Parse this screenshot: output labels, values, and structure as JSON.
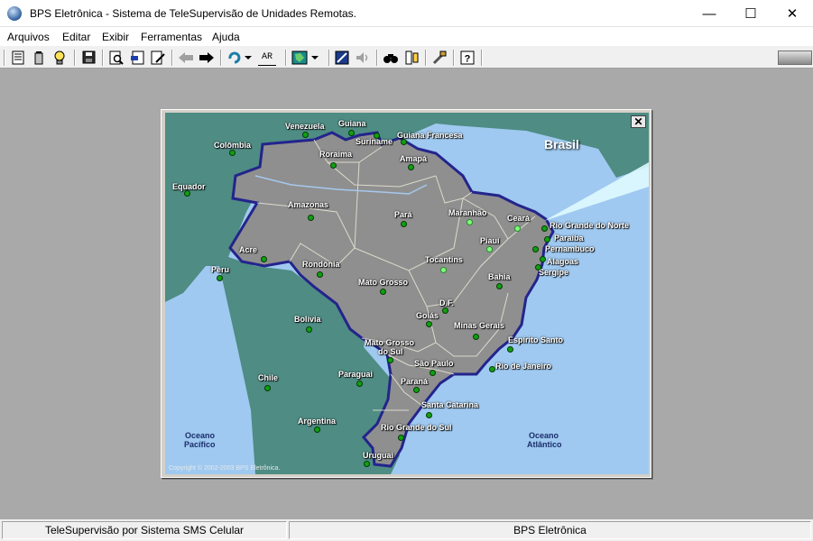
{
  "window": {
    "title": "BPS Eletrônica - Sistema de TeleSupervisão de Unidades Remotas.",
    "minimize_glyph": "—",
    "maximize_glyph": "☐",
    "close_glyph": "✕"
  },
  "menu": {
    "arquivos": "Arquivos",
    "editar": "Editar",
    "exibir": "Exibir",
    "ferramentas": "Ferramentas",
    "ajuda": "Ajuda"
  },
  "toolbar": {
    "ar_label": "AR",
    "icons": [
      "document-icon",
      "battery-icon",
      "bulb-icon",
      "save-icon",
      "print-preview-icon",
      "export-icon",
      "edit-icon",
      "back-arrow-icon",
      "forward-arrow-icon",
      "refresh-icon",
      "ar-icon",
      "map-select-icon",
      "satellite-icon",
      "speaker-icon",
      "binoculars-icon",
      "meter-icon",
      "tools-icon",
      "help-icon"
    ]
  },
  "map": {
    "title": "Brasil",
    "close_glyph": "✕",
    "copyright": "Copyright © 2002-2003 BPS Eletrônica.",
    "countries": {
      "venezuela": "Venezuela",
      "guiana": "Guiana",
      "suriname": "Suriname",
      "guiana_francesa": "Guiana Francesa",
      "colombia": "Colômbia",
      "equador": "Equador",
      "peru": "Peru",
      "bolivia": "Bolívia",
      "chile": "Chile",
      "paraguai": "Paraguai",
      "argentina": "Argentina",
      "uruguai": "Uruguai"
    },
    "oceans": {
      "pacifico_1": "Oceano",
      "pacifico_2": "Pacífico",
      "atlantico_1": "Oceano",
      "atlantico_2": "Atlântico"
    },
    "states": {
      "roraima": "Roraima",
      "amapa": "Amapá",
      "amazonas": "Amazonas",
      "para": "Pará",
      "maranhao": "Maranhão",
      "ceara": "Ceará",
      "rio_grande_do_norte": "Rio Grande do Norte",
      "paraiba": "Paraíba",
      "pernambuco": "Pernambuco",
      "alagoas": "Alagoas",
      "sergipe": "Sergipe",
      "piaui": "Piauí",
      "tocantins": "Tocantins",
      "bahia": "Bahia",
      "acre": "Acre",
      "rondonia": "Rondônia",
      "mato_grosso": "Mato Grosso",
      "df": "D.F.",
      "goias": "Goiás",
      "minas_gerais": "Minas Gerais",
      "espirito_santo": "Espírito Santo",
      "mato_grosso_do_sul_1": "Mato Grosso",
      "mato_grosso_do_sul_2": "do Sul",
      "sao_paulo": "São Paulo",
      "rio_de_janeiro": "Rio de Janeiro",
      "parana": "Paraná",
      "santa_catarina": "Santa Catarina",
      "rio_grande_do_sul": "Rio Grande do Sul"
    },
    "colors": {
      "ocean": "#9fc9f0",
      "brazil": "#8f8f8f",
      "neighbors": "#4e8c84",
      "border": "#24248c",
      "station_active": "#10a010",
      "station_lit": "#7dff7d"
    }
  },
  "status": {
    "left": "TeleSupervisão por Sistema SMS Celular",
    "right": "BPS Eletrônica"
  }
}
